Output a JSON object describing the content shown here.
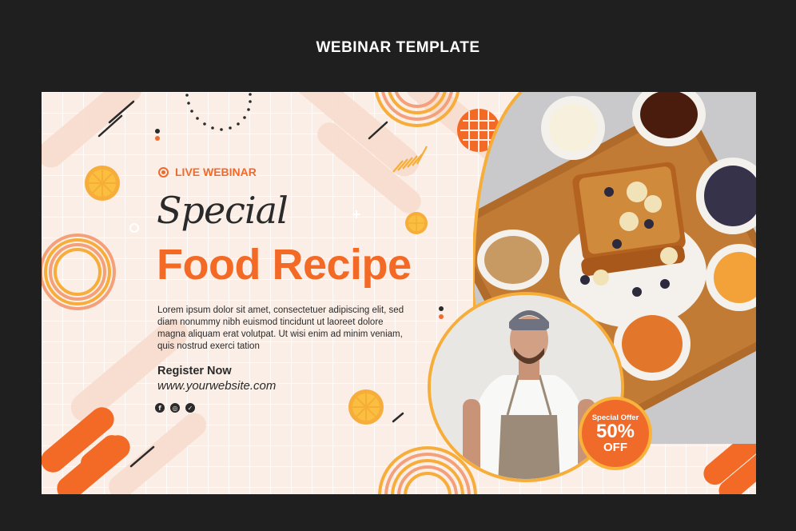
{
  "page": {
    "heading": "WEBINAR TEMPLATE"
  },
  "banner": {
    "live_label": "LIVE WEBINAR",
    "title_line1": "Special",
    "title_line2": "Food Recipe",
    "body_text": "Lorem ipsum dolor sit amet, consectetuer adipiscing elit, sed diam nonummy nibh euismod tincidunt ut laoreet dolore magna aliquam erat volutpat. Ut wisi enim ad minim veniam, quis nostrud exerci tation",
    "register_label": "Register Now",
    "website": "www.yourwebsite.com",
    "socials": [
      {
        "icon": "facebook-icon"
      },
      {
        "icon": "instagram-icon"
      },
      {
        "icon": "twitter-icon"
      }
    ],
    "offer": {
      "line1": "Special Offer",
      "percent": "50%",
      "line3": "OFF"
    }
  },
  "colors": {
    "background": "#1f1f1f",
    "banner": "#fbeee6",
    "accent_orange": "#f06a2a",
    "accent_yellow": "#f6ad3a",
    "text_dark": "#2a2a2a"
  }
}
